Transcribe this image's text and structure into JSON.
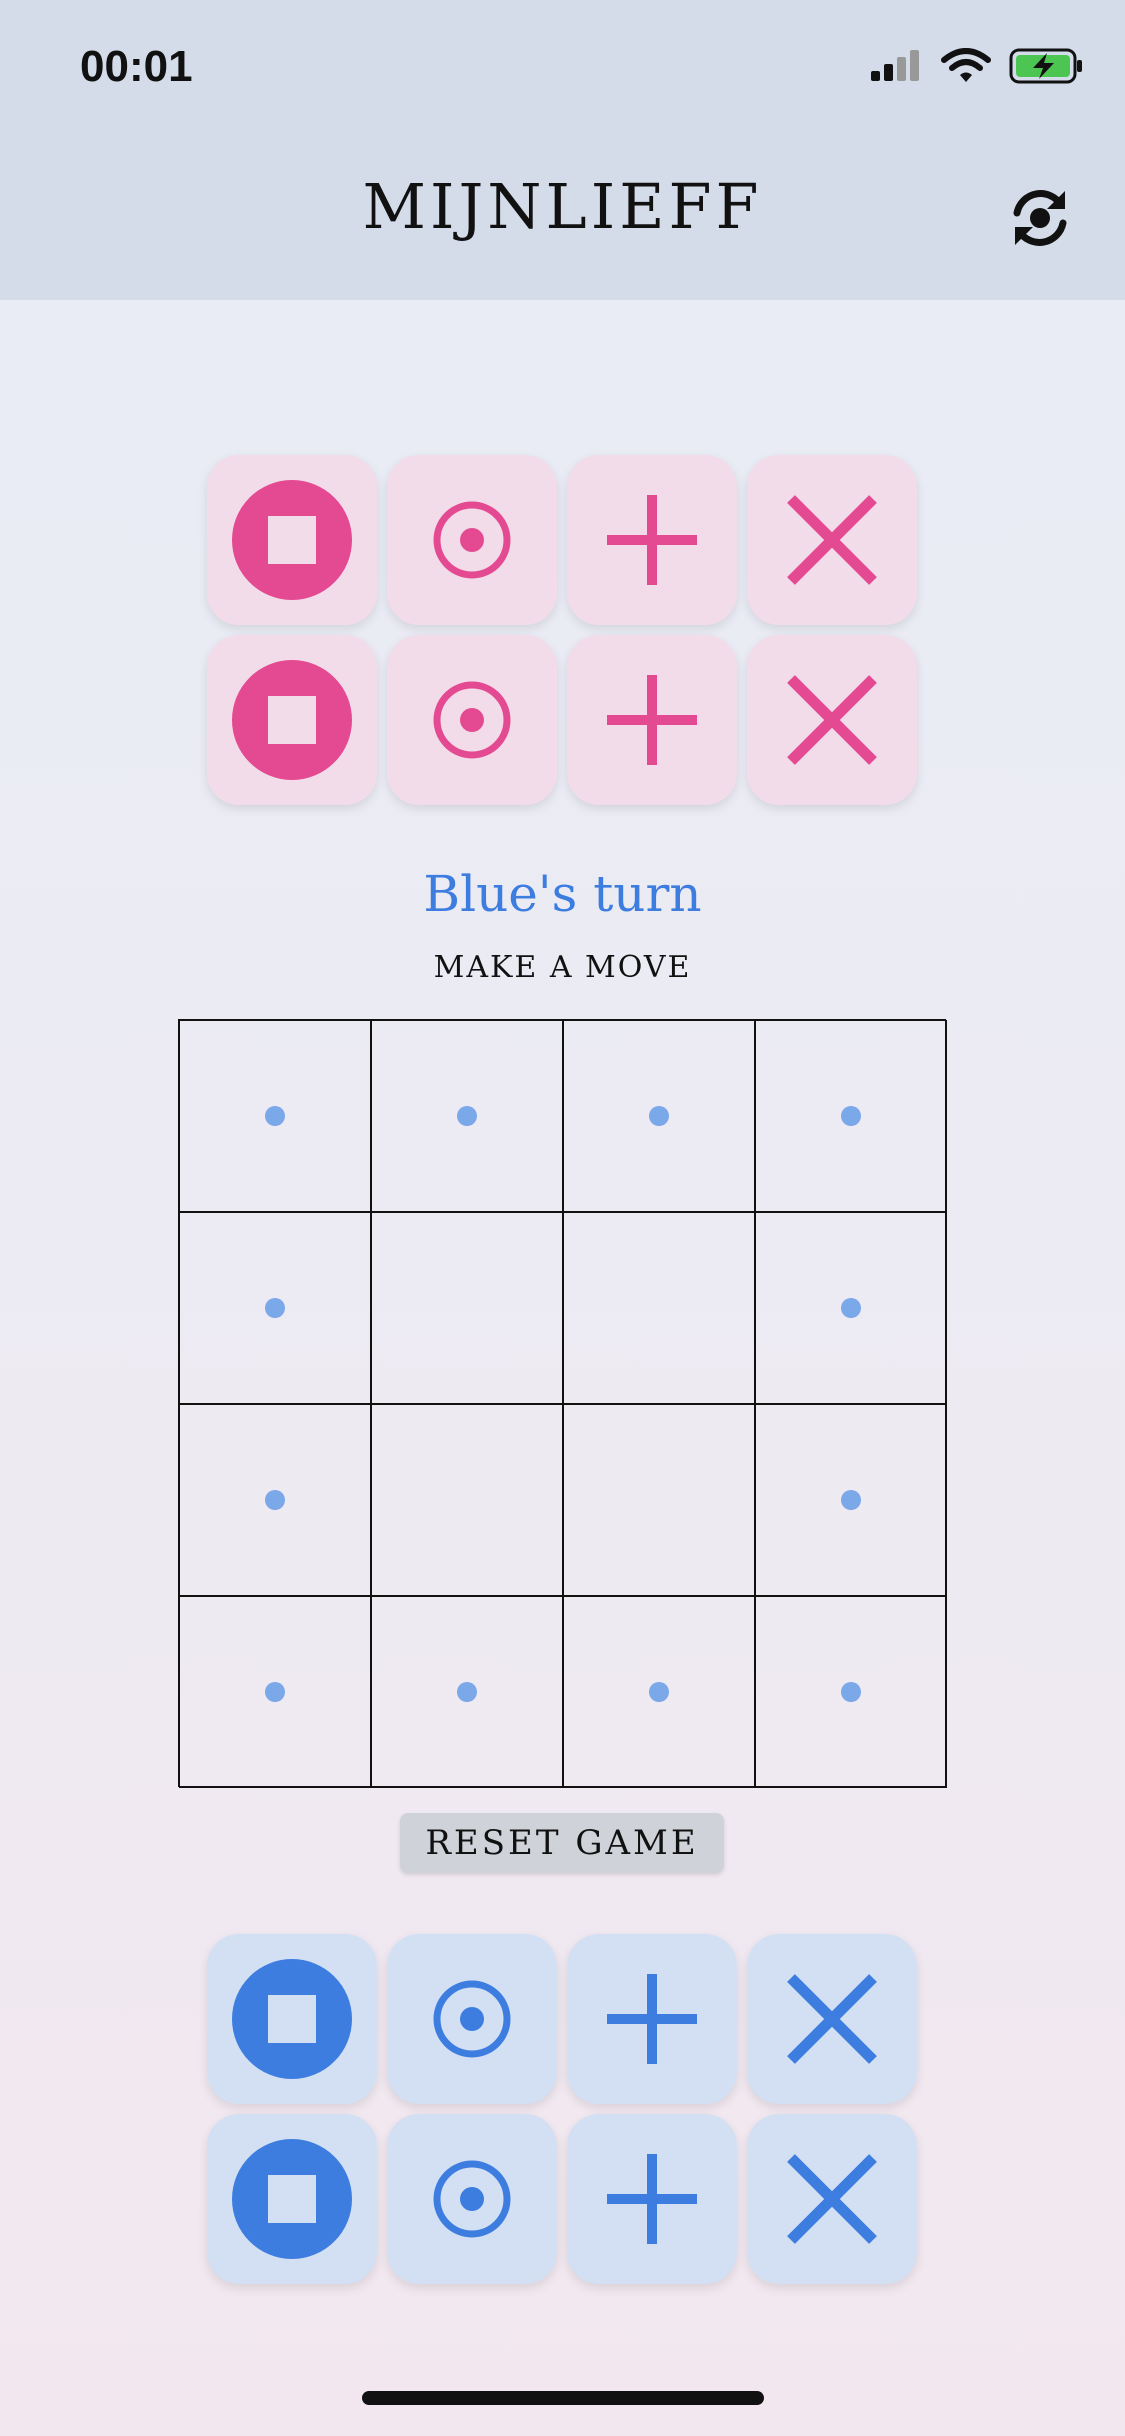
{
  "status_bar": {
    "time": "00:01"
  },
  "header": {
    "title": "MIJNLIEFF",
    "refresh_icon": "refresh-icon"
  },
  "colors": {
    "pink": "#e44a92",
    "pink_tile": "#f3dcea",
    "blue": "#3d7de0",
    "blue_tile": "#d3e0f4",
    "dot": "#7aa8e8"
  },
  "pink_palette": [
    [
      "square-in-circle-icon",
      "target-icon",
      "plus-icon",
      "cross-icon"
    ],
    [
      "square-in-circle-icon",
      "target-icon",
      "plus-icon",
      "cross-icon"
    ]
  ],
  "blue_palette": [
    [
      "square-in-circle-icon",
      "target-icon",
      "plus-icon",
      "cross-icon"
    ],
    [
      "square-in-circle-icon",
      "target-icon",
      "plus-icon",
      "cross-icon"
    ]
  ],
  "game": {
    "turn": "Blue's turn",
    "instruction": "MAKE A MOVE",
    "board": [
      [
        1,
        1,
        1,
        1
      ],
      [
        1,
        0,
        0,
        1
      ],
      [
        1,
        0,
        0,
        1
      ],
      [
        1,
        1,
        1,
        1
      ]
    ],
    "reset_label": "RESET GAME"
  }
}
